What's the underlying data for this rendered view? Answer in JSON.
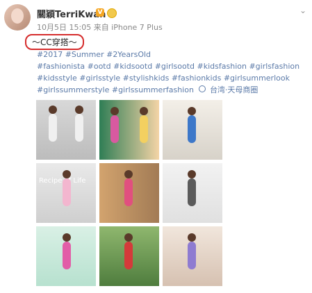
{
  "post": {
    "username": "關穎TerriKwan",
    "badge": "V",
    "meta": "10月5日 15:05 来自 iPhone 7 Plus",
    "title": "～CC穿搭～",
    "content_lines": [
      "#2017 #Summer #2YearsOld",
      "#fashionista #ootd #kidsootd #girlsootd #kidsfashion #girlsfashion",
      "#kidsstyle #girlsstyle #stylishkids #fashionkids #girlsummerlook",
      "#girlssummerstyle #girlssummerfashion"
    ],
    "location": "台湾·天母商圈",
    "photo_overlay_text": "Recipe of Life"
  },
  "icons": {
    "more": "chevron-down-icon",
    "location": "location-pin-icon",
    "verified": "verified-badge-icon",
    "crown": "crown-icon"
  }
}
